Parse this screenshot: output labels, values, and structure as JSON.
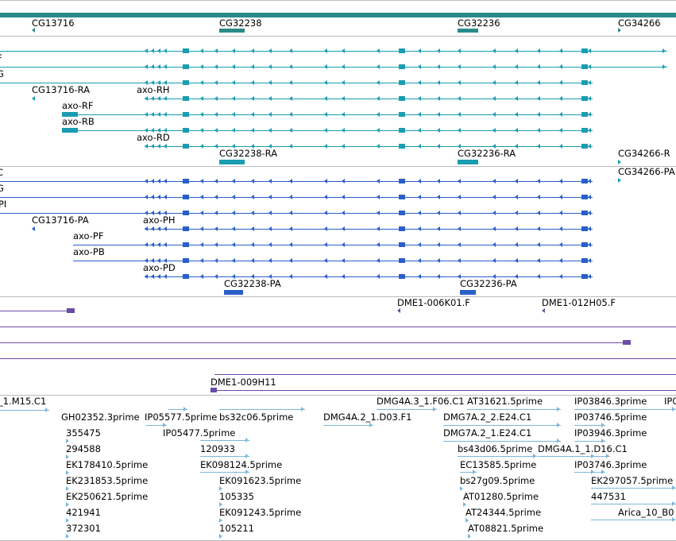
{
  "colors": {
    "teal": "#1a9db1",
    "teal_dark": "#2a8a8a",
    "blue": "#2a5fc8",
    "purple": "#6c4ca8",
    "est": "#7cb6dc",
    "separator": "#bbbbbb"
  },
  "sections": {
    "top_genes": {
      "labels": [
        "CG13716",
        "CG32238",
        "CG32236",
        "CG34266"
      ]
    },
    "transcripts_ra": {
      "edge_labels": [
        "F",
        "G"
      ],
      "labels": [
        "CG13716-RA",
        "axo-RH",
        "axo-RF",
        "axo-RB",
        "axo-RD",
        "CG32238-RA",
        "CG32236-RA",
        "CG34266-R",
        "CG34266-PA"
      ]
    },
    "translations_pa": {
      "edge_labels": [
        "C",
        "G",
        "PI"
      ],
      "labels": [
        "CG13716-PA",
        "axo-PH",
        "axo-PF",
        "axo-PB",
        "axo-PD",
        "CG32238-PA",
        "CG32236-PA"
      ]
    },
    "bac_clones": {
      "labels": [
        "DME1-006K01.F",
        "DME1-012H05.F",
        "DME1-009H11"
      ]
    },
    "est_reads": {
      "labels": [
        "_1.M15.C1",
        "GH02352.3prime",
        "IP05577.5prime",
        "bs32c06.5prime",
        "DMG4A.3_1.F06.C1",
        "AT31621.5prime",
        "IP03846.3prime",
        "IP0",
        "DMG4A.2_1.D03.F1",
        "DMG7A.2_2.E24.C1",
        "IP03746.5prime",
        "355475",
        "IP05477.5prime",
        "DMG7A.2_1.E24.C1",
        "IP03946.3prime",
        "294588",
        "120933",
        "bs43d06.5prime",
        "DMG4A.1_1.D16.C1",
        "EK178410.5prime",
        "EK098124.5prime",
        "EC13585.5prime",
        "IP03746.3prime",
        "EK231853.5prime",
        "EK091623.5prime",
        "bs27g09.5prime",
        "EK297057.5prime",
        "EK250621.5prime",
        "105335",
        "AT01280.5prime",
        "447531",
        "421941",
        "EK091243.5prime",
        "AT24344.5prime",
        "Arica_10_B0",
        "372301",
        "105211",
        "AT08821.5prime"
      ]
    }
  }
}
